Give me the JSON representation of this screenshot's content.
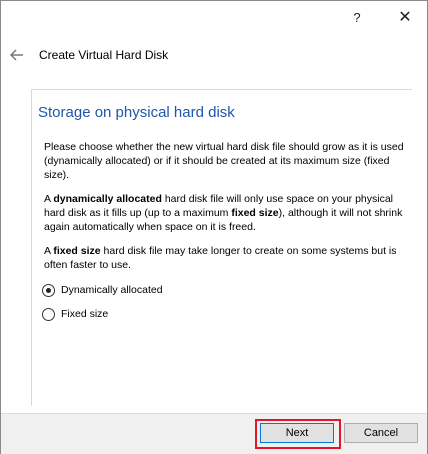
{
  "titlebar": {
    "help_label": "?",
    "close_label": "✕"
  },
  "header": {
    "back_icon": "arrow-left",
    "title": "Create Virtual Hard Disk"
  },
  "page": {
    "title": "Storage on physical hard disk",
    "paragraph1": "Please choose whether the new virtual hard disk file should grow as it is used (dynamically allocated) or if it should be created at its maximum size (fixed size).",
    "paragraph2": {
      "a": "A ",
      "b_bold": "dynamically allocated",
      "c": " hard disk file will only use space on your physical hard disk as it fills up (up to a maximum ",
      "d_bold": "fixed size",
      "e": "), although it will not shrink again automatically when space on it is freed."
    },
    "paragraph3": {
      "a": "A ",
      "b_bold": "fixed size",
      "c": " hard disk file may take longer to create on some systems but is often faster to use."
    },
    "options": [
      {
        "label": "Dynamically allocated",
        "selected": true
      },
      {
        "label": "Fixed size",
        "selected": false
      }
    ]
  },
  "footer": {
    "next_label": "Next",
    "cancel_label": "Cancel"
  },
  "colors": {
    "title_blue": "#1f57a8",
    "highlight_red": "#e0162b"
  }
}
